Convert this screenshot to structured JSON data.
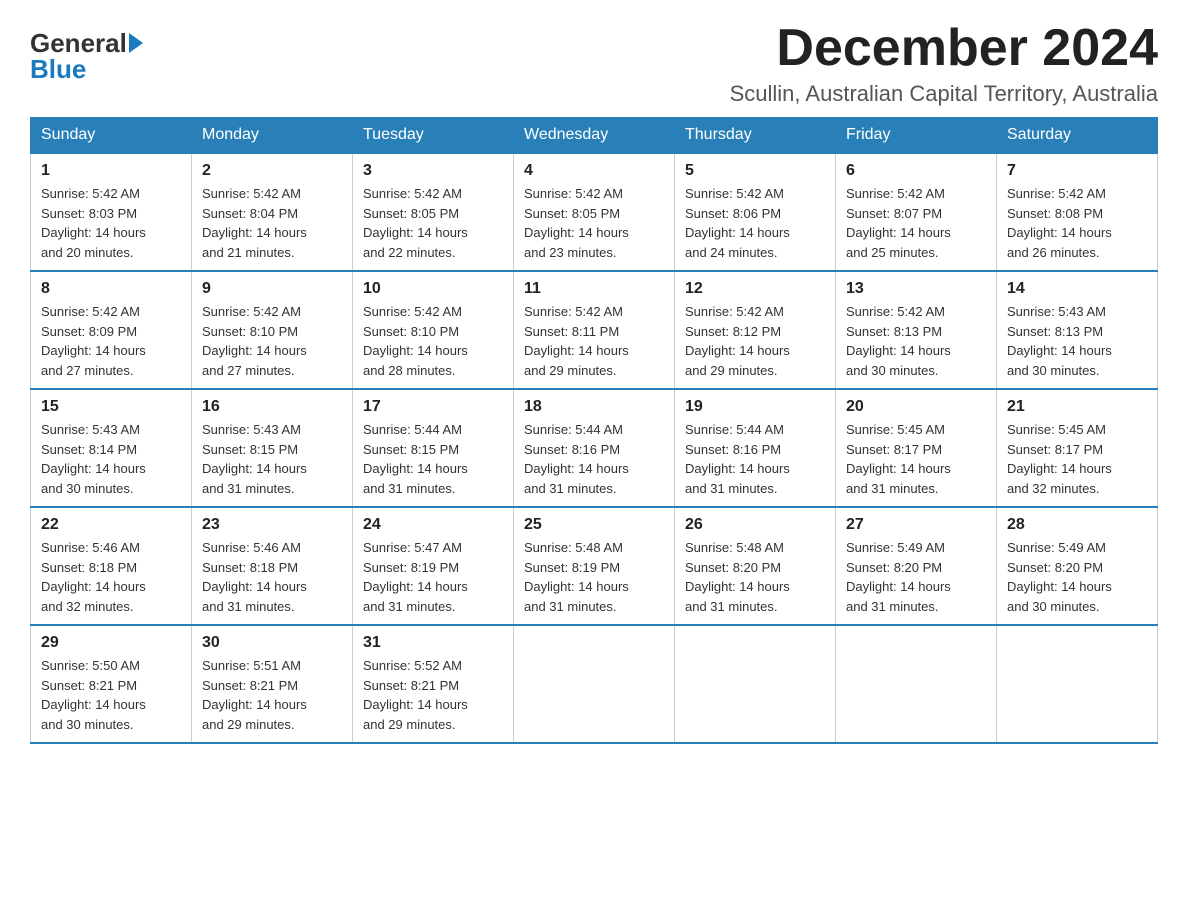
{
  "header": {
    "logo_general": "General",
    "logo_blue": "Blue",
    "month_title": "December 2024",
    "location": "Scullin, Australian Capital Territory, Australia"
  },
  "days_of_week": [
    "Sunday",
    "Monday",
    "Tuesday",
    "Wednesday",
    "Thursday",
    "Friday",
    "Saturday"
  ],
  "weeks": [
    [
      {
        "day": "1",
        "sunrise": "5:42 AM",
        "sunset": "8:03 PM",
        "daylight": "14 hours and 20 minutes."
      },
      {
        "day": "2",
        "sunrise": "5:42 AM",
        "sunset": "8:04 PM",
        "daylight": "14 hours and 21 minutes."
      },
      {
        "day": "3",
        "sunrise": "5:42 AM",
        "sunset": "8:05 PM",
        "daylight": "14 hours and 22 minutes."
      },
      {
        "day": "4",
        "sunrise": "5:42 AM",
        "sunset": "8:05 PM",
        "daylight": "14 hours and 23 minutes."
      },
      {
        "day": "5",
        "sunrise": "5:42 AM",
        "sunset": "8:06 PM",
        "daylight": "14 hours and 24 minutes."
      },
      {
        "day": "6",
        "sunrise": "5:42 AM",
        "sunset": "8:07 PM",
        "daylight": "14 hours and 25 minutes."
      },
      {
        "day": "7",
        "sunrise": "5:42 AM",
        "sunset": "8:08 PM",
        "daylight": "14 hours and 26 minutes."
      }
    ],
    [
      {
        "day": "8",
        "sunrise": "5:42 AM",
        "sunset": "8:09 PM",
        "daylight": "14 hours and 27 minutes."
      },
      {
        "day": "9",
        "sunrise": "5:42 AM",
        "sunset": "8:10 PM",
        "daylight": "14 hours and 27 minutes."
      },
      {
        "day": "10",
        "sunrise": "5:42 AM",
        "sunset": "8:10 PM",
        "daylight": "14 hours and 28 minutes."
      },
      {
        "day": "11",
        "sunrise": "5:42 AM",
        "sunset": "8:11 PM",
        "daylight": "14 hours and 29 minutes."
      },
      {
        "day": "12",
        "sunrise": "5:42 AM",
        "sunset": "8:12 PM",
        "daylight": "14 hours and 29 minutes."
      },
      {
        "day": "13",
        "sunrise": "5:42 AM",
        "sunset": "8:13 PM",
        "daylight": "14 hours and 30 minutes."
      },
      {
        "day": "14",
        "sunrise": "5:43 AM",
        "sunset": "8:13 PM",
        "daylight": "14 hours and 30 minutes."
      }
    ],
    [
      {
        "day": "15",
        "sunrise": "5:43 AM",
        "sunset": "8:14 PM",
        "daylight": "14 hours and 30 minutes."
      },
      {
        "day": "16",
        "sunrise": "5:43 AM",
        "sunset": "8:15 PM",
        "daylight": "14 hours and 31 minutes."
      },
      {
        "day": "17",
        "sunrise": "5:44 AM",
        "sunset": "8:15 PM",
        "daylight": "14 hours and 31 minutes."
      },
      {
        "day": "18",
        "sunrise": "5:44 AM",
        "sunset": "8:16 PM",
        "daylight": "14 hours and 31 minutes."
      },
      {
        "day": "19",
        "sunrise": "5:44 AM",
        "sunset": "8:16 PM",
        "daylight": "14 hours and 31 minutes."
      },
      {
        "day": "20",
        "sunrise": "5:45 AM",
        "sunset": "8:17 PM",
        "daylight": "14 hours and 31 minutes."
      },
      {
        "day": "21",
        "sunrise": "5:45 AM",
        "sunset": "8:17 PM",
        "daylight": "14 hours and 32 minutes."
      }
    ],
    [
      {
        "day": "22",
        "sunrise": "5:46 AM",
        "sunset": "8:18 PM",
        "daylight": "14 hours and 32 minutes."
      },
      {
        "day": "23",
        "sunrise": "5:46 AM",
        "sunset": "8:18 PM",
        "daylight": "14 hours and 31 minutes."
      },
      {
        "day": "24",
        "sunrise": "5:47 AM",
        "sunset": "8:19 PM",
        "daylight": "14 hours and 31 minutes."
      },
      {
        "day": "25",
        "sunrise": "5:48 AM",
        "sunset": "8:19 PM",
        "daylight": "14 hours and 31 minutes."
      },
      {
        "day": "26",
        "sunrise": "5:48 AM",
        "sunset": "8:20 PM",
        "daylight": "14 hours and 31 minutes."
      },
      {
        "day": "27",
        "sunrise": "5:49 AM",
        "sunset": "8:20 PM",
        "daylight": "14 hours and 31 minutes."
      },
      {
        "day": "28",
        "sunrise": "5:49 AM",
        "sunset": "8:20 PM",
        "daylight": "14 hours and 30 minutes."
      }
    ],
    [
      {
        "day": "29",
        "sunrise": "5:50 AM",
        "sunset": "8:21 PM",
        "daylight": "14 hours and 30 minutes."
      },
      {
        "day": "30",
        "sunrise": "5:51 AM",
        "sunset": "8:21 PM",
        "daylight": "14 hours and 29 minutes."
      },
      {
        "day": "31",
        "sunrise": "5:52 AM",
        "sunset": "8:21 PM",
        "daylight": "14 hours and 29 minutes."
      },
      null,
      null,
      null,
      null
    ]
  ],
  "labels": {
    "sunrise": "Sunrise:",
    "sunset": "Sunset:",
    "daylight": "Daylight:"
  }
}
